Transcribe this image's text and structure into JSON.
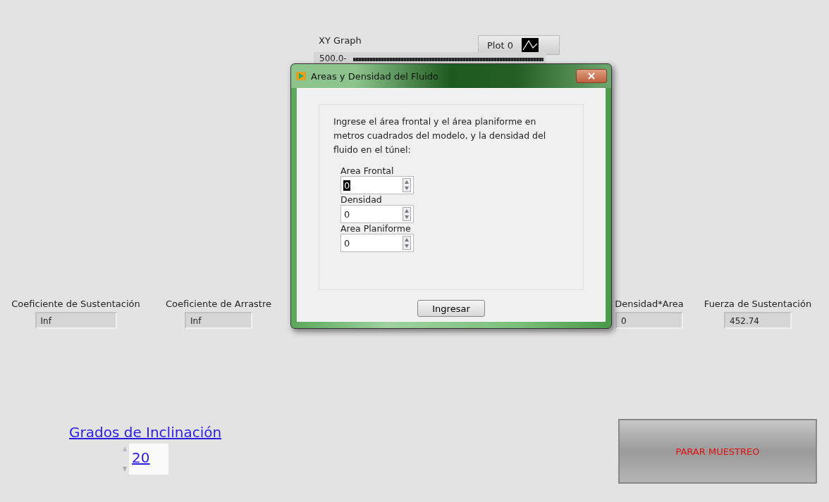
{
  "graph": {
    "label": "XY Graph",
    "legend": "Plot 0",
    "y_tick_top": "500.0-"
  },
  "indicators": [
    {
      "label": "Coeficiente de Sustentación",
      "value": "Inf"
    },
    {
      "label": "Coeficiente de Arrastre",
      "value": "Inf"
    },
    {
      "label": "Densidad*Area",
      "value": "0"
    },
    {
      "label": "Fuerza de Sustentación",
      "value": "452.74"
    }
  ],
  "inclination": {
    "label": "Grados de Inclinación",
    "value": "20"
  },
  "stop_button": {
    "label": "PARAR MUESTREO"
  },
  "dialog": {
    "title": "Areas y Densidad del Fluido",
    "message": "Ingrese el área frontal y el área planiforme en metros cuadrados del modelo, y la densidad del fluido en el túnel:",
    "fields": [
      {
        "label": "Area Frontal",
        "value": "0",
        "selected": true
      },
      {
        "label": "Densidad",
        "value": "0",
        "selected": false
      },
      {
        "label": "Area Planiforme",
        "value": "0",
        "selected": false
      }
    ],
    "button": "Ingresar"
  }
}
